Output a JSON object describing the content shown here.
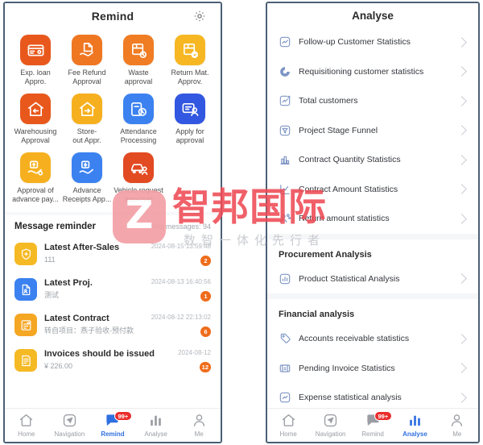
{
  "left_panel": {
    "header": {
      "title": "Remind",
      "settings_icon": "gear-icon"
    },
    "apps": [
      {
        "label": "Exp. loan\nAppro.",
        "icon": "expense-loan-card-icon",
        "color": "#e8581c"
      },
      {
        "label": "Fee Refund\nApproval",
        "icon": "fee-refund-hand-icon",
        "color": "#ef7722"
      },
      {
        "label": "Waste approval",
        "icon": "waste-box-icon",
        "color": "#f07c23"
      },
      {
        "label": "Return Mat.\nApprov.",
        "icon": "return-material-box-icon",
        "color": "#f6b723"
      },
      {
        "label": "Warehousing\nApproval",
        "icon": "warehousing-house-in-icon",
        "color": "#e8581c"
      },
      {
        "label": "Store-\nout Appr.",
        "icon": "storeout-house-out-icon",
        "color": "#f6b01f"
      },
      {
        "label": "Attendance\nProcessing",
        "icon": "attendance-clock-icon",
        "color": "#3b82f0"
      },
      {
        "label": "Apply for\napproval",
        "icon": "apply-approval-person-icon",
        "color": "#3257e0"
      },
      {
        "label": "Approval of\nadvance pay...",
        "icon": "advance-payment-hand-icon",
        "color": "#f6b01f"
      },
      {
        "label": "Advance\nReceipts App...",
        "icon": "advance-receipt-hand-icon",
        "color": "#3b82f0"
      },
      {
        "label": "Vehicle request\napproval",
        "icon": "vehicle-car-icon",
        "color": "#e24a22"
      }
    ],
    "messages": {
      "section_title": "Message reminder",
      "total_label": "Total messages: 94",
      "items": [
        {
          "title": "Latest After-Sales",
          "subtitle": "111",
          "time": "2024-08-15 13:59:48",
          "badge": "2",
          "icon": "shield-plus-icon",
          "color": "#f5b924"
        },
        {
          "title": "Latest Proj.",
          "subtitle": "测试",
          "time": "2024-08-13 16:40:56",
          "badge": "1",
          "icon": "project-doc-icon",
          "color": "#3b82f0"
        },
        {
          "title": "Latest Contract",
          "subtitle": "转自项目：燕子验收-预付款",
          "time": "2024-08-12 22:13:02",
          "badge": "6",
          "icon": "contract-file-icon",
          "color": "#f5a623"
        },
        {
          "title": "Invoices should be issued",
          "subtitle": "¥ 226.00",
          "time": "2024-08-12",
          "badge": "12",
          "icon": "invoice-icon",
          "color": "#f5b924"
        }
      ]
    },
    "tabbar": {
      "active": "Remind",
      "items": [
        {
          "label": "Home",
          "icon": "home-icon"
        },
        {
          "label": "Navigation",
          "icon": "navigation-compass-icon"
        },
        {
          "label": "Remind",
          "icon": "remind-chat-icon",
          "badge": "99+"
        },
        {
          "label": "Analyse",
          "icon": "analyse-bars-icon"
        },
        {
          "label": "Me",
          "icon": "person-icon"
        }
      ]
    }
  },
  "right_panel": {
    "header": {
      "title": "Analyse"
    },
    "groups": [
      {
        "section": "",
        "rows": [
          {
            "label": "Follow-up Customer Statistics",
            "icon": "trend-square-icon"
          },
          {
            "label": "Requisitioning customer statistics",
            "icon": "pie-donut-icon"
          },
          {
            "label": "Total customers",
            "icon": "trend-up-square-icon"
          },
          {
            "label": "Project Stage Funnel",
            "icon": "funnel-square-icon"
          },
          {
            "label": "Contract Quantity Statistics",
            "icon": "bar-chart-icon"
          },
          {
            "label": "Contract Amount Statistics",
            "icon": "line-chart-icon"
          },
          {
            "label": "Return amount statistics",
            "icon": "return-amount-icon"
          }
        ]
      },
      {
        "section": "Procurement Analysis",
        "rows": [
          {
            "label": "Product Statistical Analysis",
            "icon": "product-bar-square-icon"
          }
        ]
      },
      {
        "section": "Financial analysis",
        "rows": [
          {
            "label": "Accounts receivable statistics",
            "icon": "receivable-icon"
          },
          {
            "label": "Pending Invoice Statistics",
            "icon": "pending-invoice-icon"
          },
          {
            "label": "Expense statistical analysis",
            "icon": "expense-square-icon"
          }
        ]
      }
    ],
    "tabbar": {
      "active": "Analyse",
      "items": [
        {
          "label": "Home",
          "icon": "home-icon"
        },
        {
          "label": "Navigation",
          "icon": "navigation-compass-icon"
        },
        {
          "label": "Remind",
          "icon": "remind-chat-icon",
          "badge": "99+"
        },
        {
          "label": "Analyse",
          "icon": "analyse-bars-icon"
        },
        {
          "label": "Me",
          "icon": "person-icon"
        }
      ]
    }
  },
  "watermark": {
    "mark": "Z",
    "brand": "智邦国际",
    "tagline": "数智一体化先行者",
    "brand_color": "#ef4b55",
    "mark_bg": "#f2a0a6"
  }
}
